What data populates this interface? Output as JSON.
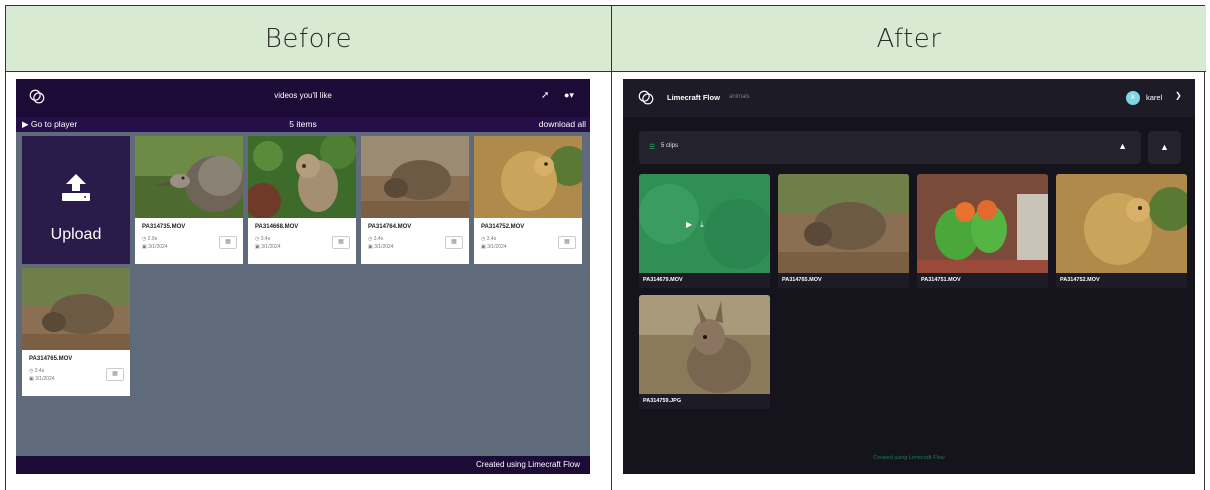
{
  "comparison": {
    "before_label": "Before",
    "after_label": "After"
  },
  "before": {
    "header_title": "videos you'll like",
    "go_to_player": "Go to player",
    "items_count": "5 items",
    "download_all": "download all",
    "upload_label": "Upload",
    "footer": "Created using Limecraft Flow",
    "cards": [
      {
        "filename": "PA314735.MOV",
        "duration": "2.9s",
        "date": "3/1/2024"
      },
      {
        "filename": "PA314668.MOV",
        "duration": "3.4s",
        "date": "3/1/2024"
      },
      {
        "filename": "PA314764.MOV",
        "duration": "3.4s",
        "date": "3/1/2024"
      },
      {
        "filename": "PA314752.MOV",
        "duration": "3.4s",
        "date": "3/1/2024"
      },
      {
        "filename": "PA314765.MOV",
        "duration": "3.4s",
        "date": "3/1/2024"
      }
    ]
  },
  "after": {
    "app_name": "Limecraft Flow",
    "breadcrumb": "animals",
    "user_initial": "k",
    "user_name": "karel",
    "clips_count": "5 clips",
    "footer": "Created using Limecraft Flow",
    "cards": [
      {
        "filename": "PA314679.MOV"
      },
      {
        "filename": "PA314765.MOV"
      },
      {
        "filename": "PA314751.MOV"
      },
      {
        "filename": "PA314752.MOV"
      },
      {
        "filename": "PA314759.JPG"
      }
    ]
  },
  "colors": {
    "header_bg": "#d9ead3",
    "before_nav": "#1c0b36",
    "before_body": "#5f6b7a",
    "after_bg": "#15141d",
    "accent_green": "#2ebf6e"
  },
  "icons": [
    "logo-icon",
    "play-circle-icon",
    "upload-icon",
    "filmstrip-icon",
    "clock-icon",
    "calendar-icon",
    "user-icon",
    "download-icon",
    "play-icon",
    "chevron-down-icon",
    "list-icon"
  ]
}
